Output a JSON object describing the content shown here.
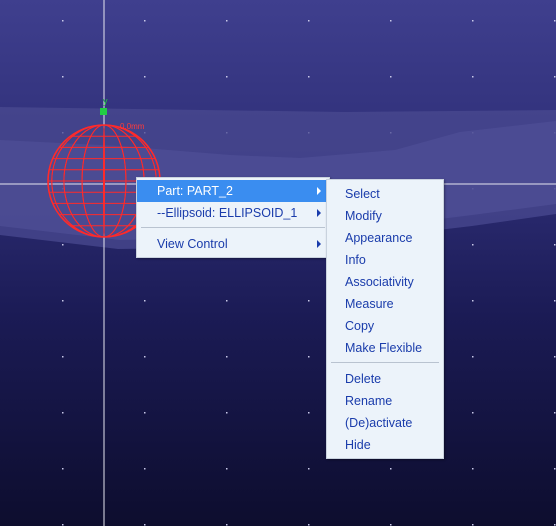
{
  "viewport": {
    "triad_label": "y",
    "dimension_label": "0.0mm"
  },
  "context_menu": {
    "items": [
      {
        "label": "Part: PART_2"
      },
      {
        "label": "--Ellipsoid: ELLIPSOID_1"
      },
      {
        "label": "View Control"
      }
    ]
  },
  "submenu": {
    "items": [
      {
        "label": "Select"
      },
      {
        "label": "Modify"
      },
      {
        "label": "Appearance"
      },
      {
        "label": "Info"
      },
      {
        "label": "Associativity"
      },
      {
        "label": "Measure"
      },
      {
        "label": "Copy"
      },
      {
        "label": "Make Flexible"
      },
      {
        "label": "Delete"
      },
      {
        "label": "Rename"
      },
      {
        "label": "(De)activate"
      },
      {
        "label": "Hide"
      }
    ]
  },
  "colors": {
    "background_top": "#3f3f8e",
    "background_bottom": "#0d0d2e",
    "highlight": "#3a8df0",
    "menu_text": "#1a3cab",
    "menu_background": "#ecf3fa",
    "ellipsoid": "#ff2a2a",
    "triad": "#22cc44"
  }
}
